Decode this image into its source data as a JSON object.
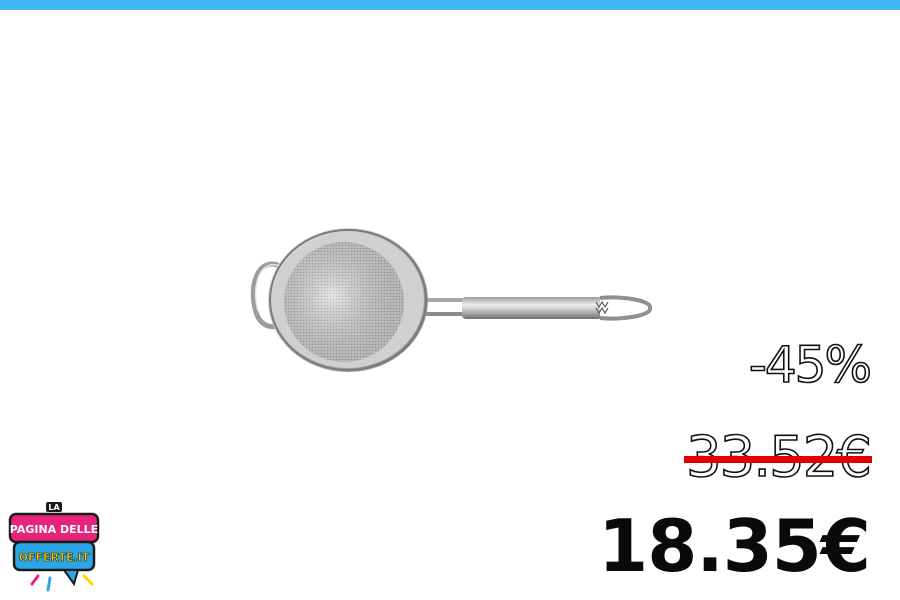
{
  "colors": {
    "top_bar": "#3fb5f5",
    "strike": "#e00000",
    "logo_pink": "#e8247a",
    "logo_blue": "#2aa6e6",
    "logo_yellow": "#ffd200"
  },
  "product": {
    "icon": "strainer-image"
  },
  "pricing": {
    "discount": "-45%",
    "old_price": "33.52€",
    "new_price": "18.35€"
  },
  "logo": {
    "line1": "LA",
    "line2": "PAGINA DELLE",
    "line3": "OFFERTE.IT"
  }
}
